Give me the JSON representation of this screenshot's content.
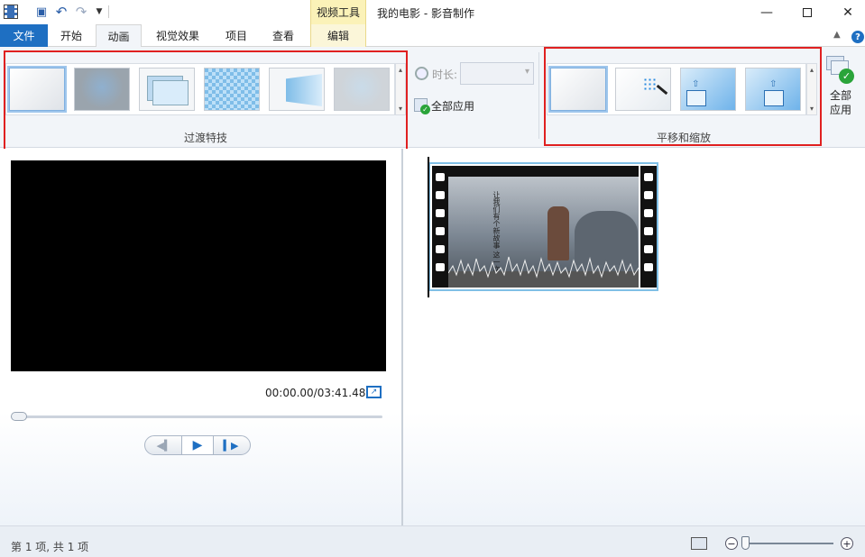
{
  "titlebar": {
    "context_tab": "视频工具",
    "title": "我的电影 - 影音制作",
    "minimize": "—",
    "close": "✕"
  },
  "tabs": {
    "file": "文件",
    "home": "开始",
    "animations": "动画",
    "visual_effects": "视觉效果",
    "project": "项目",
    "view": "查看",
    "edit": "编辑"
  },
  "ribbon": {
    "transitions_label": "过渡特技",
    "duration_label": "时长:",
    "apply_all_label": "全部应用",
    "pan_zoom_label": "平移和缩放",
    "apply_all_big_label": "全部应用",
    "help": "?",
    "transitions": [
      {
        "name": "none"
      },
      {
        "name": "blur"
      },
      {
        "name": "cross-fade"
      },
      {
        "name": "mosaic"
      },
      {
        "name": "flip"
      },
      {
        "name": "fade-person"
      }
    ],
    "pan_zoom": [
      {
        "name": "none"
      },
      {
        "name": "auto"
      },
      {
        "name": "zoom-in"
      },
      {
        "name": "zoom-in-2"
      }
    ]
  },
  "preview": {
    "timecode": "00:00.00/03:41.48",
    "progress": 0
  },
  "storyboard": {
    "clip_caption_col1": "让我们有个新故事",
    "clip_caption_col2": "这一次"
  },
  "statusbar": {
    "text": "第 1 项, 共 1 项",
    "zoom_out": "−",
    "zoom_in": "+"
  },
  "colors": {
    "accent": "#1e6fc2",
    "highlight": "#e02020",
    "context_tab": "#fbf2b8"
  }
}
